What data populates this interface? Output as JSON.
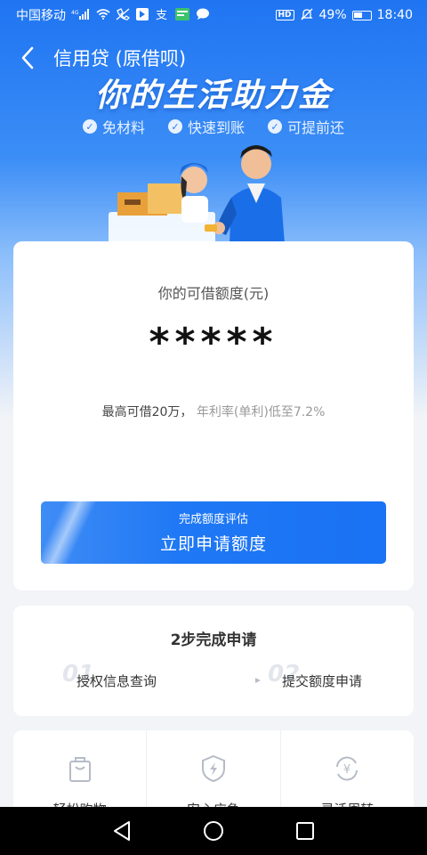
{
  "status_bar": {
    "carrier": "中国移动",
    "network": "4G",
    "battery_percent": "49%",
    "time": "18:40",
    "hd_label": "HD",
    "icons": [
      "signal-icon",
      "wifi-icon",
      "no-call-icon",
      "app-notification-icon",
      "payment-app-icon",
      "message-icon",
      "mute-icon",
      "battery-icon"
    ]
  },
  "nav": {
    "title": "信用贷 (原借呗)"
  },
  "hero": {
    "slogan": "你的生活助力金",
    "features": [
      {
        "label": "免材料"
      },
      {
        "label": "快速到账"
      },
      {
        "label": "可提前还"
      }
    ]
  },
  "credit": {
    "label": "你的可借额度(元)",
    "amount": "*****",
    "max_text": "最高可借20万，",
    "rate_text": "年利率(单利)低至7.2%",
    "button_sub": "完成额度评估",
    "button_main": "立即申请额度"
  },
  "steps": {
    "title": "2步完成申请",
    "items": [
      {
        "number": "01",
        "label": "授权信息查询"
      },
      {
        "number": "02",
        "label": "提交额度申请"
      }
    ]
  },
  "benefits": [
    {
      "label": "轻松购物",
      "icon": "shopping-bag-icon"
    },
    {
      "label": "安心应急",
      "icon": "shield-lightning-icon"
    },
    {
      "label": "灵活周转",
      "icon": "yuan-cycle-icon"
    }
  ],
  "colors": {
    "primary": "#1a72f4",
    "hero_top": "#1f74f2",
    "background": "#f2f4f7"
  }
}
